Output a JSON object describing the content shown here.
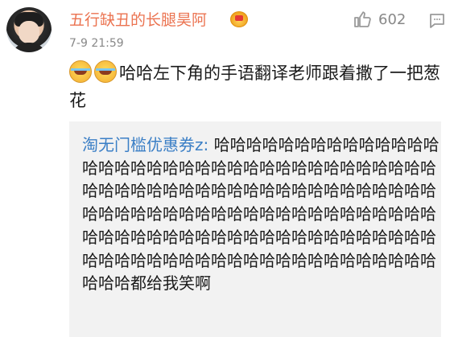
{
  "comment": {
    "username": "五行缺丑的长腿昊阿",
    "timestamp": "7-9 21:59",
    "like_count": "602",
    "text": "哈哈左下角的手语翻译老师跟着撒了一把葱花",
    "emojis": [
      "laugh-cry-emoji",
      "laugh-cry-emoji"
    ]
  },
  "reply": {
    "author": "淘无门槛优惠券z:",
    "text": " 哈哈哈哈哈哈哈哈哈哈哈哈哈哈哈哈哈哈哈哈哈哈哈哈哈哈哈哈哈哈哈哈哈哈哈哈哈哈哈哈哈哈哈哈哈哈哈哈哈哈哈哈哈哈哈哈哈哈哈哈哈哈哈哈哈哈哈哈哈哈哈哈哈哈哈哈哈哈哈哈哈哈哈哈哈哈哈哈哈哈哈哈哈哈哈哈哈哈哈哈哈哈哈哈哈哈哈哈哈哈哈哈哈哈哈哈哈哈哈哈哈哈哈哈哈哈哈都给我笑啊"
  },
  "colors": {
    "username": "#eb7350",
    "link": "#3b7fc6",
    "meta": "#888888",
    "quote_bg": "#f2f2f2"
  }
}
